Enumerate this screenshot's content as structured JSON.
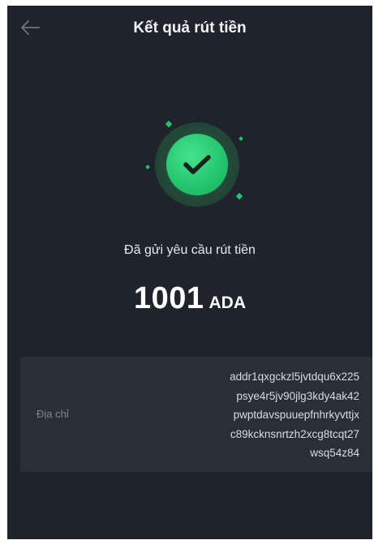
{
  "header": {
    "title": "Kết quả rút tiền",
    "back_icon": "arrow-left-icon"
  },
  "result": {
    "status_text": "Đã gửi yêu cầu rút tiền",
    "amount": "1001",
    "unit": "ADA",
    "icon": "checkmark-icon"
  },
  "address": {
    "label": "Địa chỉ",
    "lines": [
      "addr1qxgckzl5jvtdqu6x225",
      "psye4r5jv90jlg3kdy4ak42",
      "pwptdavspuuepfnhrkyvttjx",
      "c89kcknsnrtzh2xcg8tcqt27",
      "wsq54z84"
    ]
  },
  "colors": {
    "background": "#1f232b",
    "card": "#2a2f37",
    "accent": "#22c46d"
  }
}
